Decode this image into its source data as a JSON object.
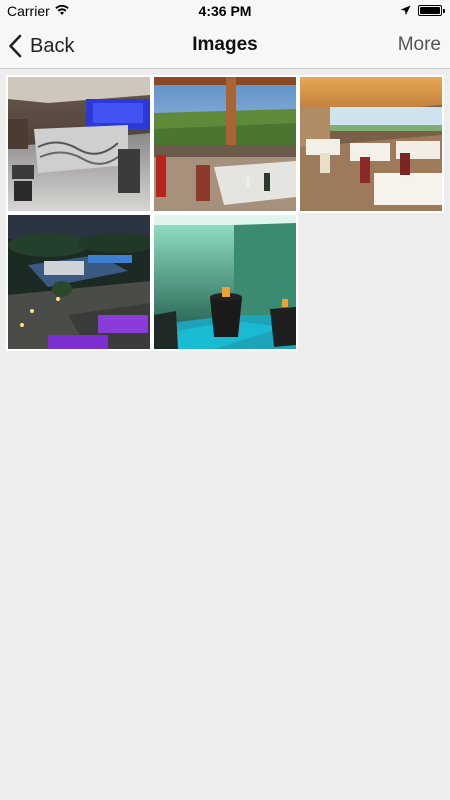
{
  "status_bar": {
    "carrier": "Carrier",
    "time": "4:36 PM"
  },
  "nav": {
    "back_label": "Back",
    "title": "Images",
    "more_label": "More"
  },
  "gallery": {
    "images": [
      {
        "name": "bar-interior"
      },
      {
        "name": "terrace-view"
      },
      {
        "name": "dining-room"
      },
      {
        "name": "night-garden-pool"
      },
      {
        "name": "lounge-green"
      }
    ]
  },
  "colors": {
    "nav_background": "#f7f7f7",
    "page_background": "#ededed"
  }
}
